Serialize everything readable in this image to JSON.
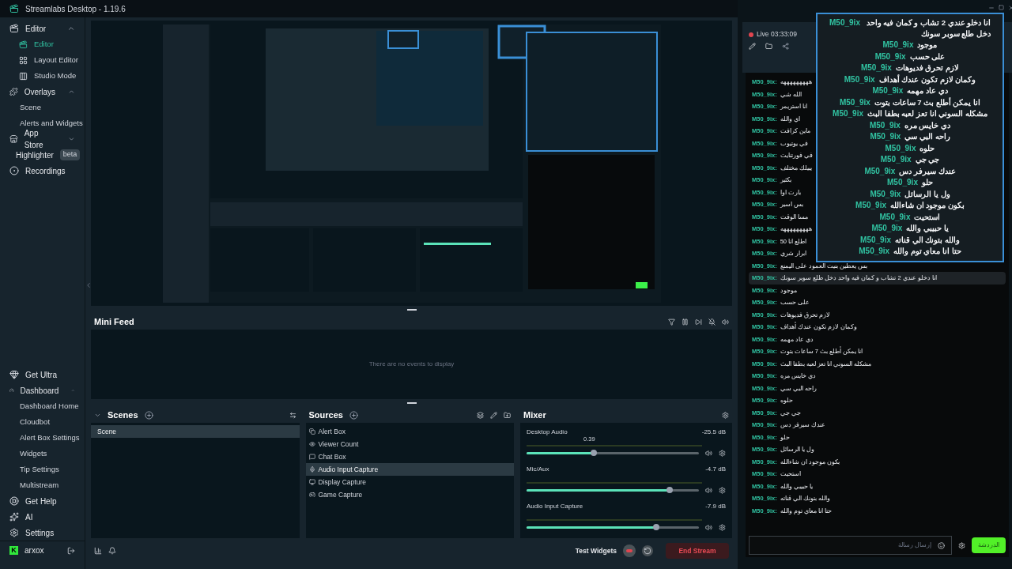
{
  "window": {
    "title": "Streamlabs Desktop - 1.19.6"
  },
  "sidebar": {
    "top_items": [
      {
        "label": "Editor",
        "expanded": true,
        "children": [
          {
            "label": "Editor",
            "selected": true
          },
          {
            "label": "Layout Editor",
            "selected": false
          },
          {
            "label": "Studio Mode",
            "selected": false
          }
        ]
      },
      {
        "label": "Overlays",
        "expanded": true,
        "children": [
          {
            "label": "Scene",
            "selected": false
          },
          {
            "label": "Alerts and Widgets",
            "selected": false
          }
        ]
      },
      {
        "label": "App Store",
        "expanded": false
      },
      {
        "label": "Highlighter",
        "badge": "beta"
      },
      {
        "label": "Recordings"
      }
    ],
    "bottom_items": [
      {
        "label": "Get Ultra"
      },
      {
        "label": "Dashboard",
        "expanded": true,
        "children": [
          {
            "label": "Dashboard Home",
            "selected": false
          },
          {
            "label": "Cloudbot",
            "selected": false
          },
          {
            "label": "Alert Box Settings",
            "selected": false
          },
          {
            "label": "Widgets",
            "selected": false
          },
          {
            "label": "Tip Settings",
            "selected": false
          },
          {
            "label": "Multistream",
            "selected": false
          }
        ]
      },
      {
        "label": "Get Help"
      },
      {
        "label": "AI"
      },
      {
        "label": "Settings"
      }
    ],
    "user": {
      "initial": "K",
      "name": "arxox"
    }
  },
  "mini_feed": {
    "title": "Mini Feed",
    "empty_text": "There are no events to display"
  },
  "scenes": {
    "title": "Scenes",
    "items": [
      {
        "label": "Scene",
        "selected": true
      }
    ]
  },
  "sources": {
    "title": "Sources",
    "items": [
      {
        "label": "Alert Box",
        "selected": false
      },
      {
        "label": "Viewer Count",
        "selected": false
      },
      {
        "label": "Chat Box",
        "selected": false
      },
      {
        "label": "Audio Input Capture",
        "selected": true
      },
      {
        "label": "Display Capture",
        "selected": false
      },
      {
        "label": "Game Capture",
        "selected": false
      }
    ]
  },
  "mixer": {
    "title": "Mixer",
    "channels": [
      {
        "name": "Desktop Audio",
        "reading": "-25.5 dB",
        "level": 0.39,
        "value_tip": "0.39"
      },
      {
        "name": "Mic/Aux",
        "reading": "-4.7 dB",
        "level": 0.83
      },
      {
        "name": "Audio Input Capture",
        "reading": "-7.9 dB",
        "level": 0.75
      }
    ]
  },
  "footer": {
    "test_widgets": "Test Widgets",
    "end_stream": "End Stream"
  },
  "chat": {
    "live": "Live 03:33:09",
    "messages": [
      {
        "user": "M50_9ix:",
        "text": "هههههههههه",
        "highlighted": false
      },
      {
        "user": "M50_9ix:",
        "text": "الله شي",
        "highlighted": false
      },
      {
        "user": "M50_9ix:",
        "text": "انا استريمر",
        "highlighted": false
      },
      {
        "user": "M50_9ix:",
        "text": "اي والله",
        "highlighted": false
      },
      {
        "user": "M50_9ix:",
        "text": "ماين كرافت",
        "highlighted": false
      },
      {
        "user": "M50_9ix:",
        "text": "في يوتيوب",
        "highlighted": false
      },
      {
        "user": "M50_9ix:",
        "text": "في فورتنايت",
        "highlighted": false
      },
      {
        "user": "M50_9ix:",
        "text": "يبيلك مختلف",
        "highlighted": false
      },
      {
        "user": "M50_9ix:",
        "text": "بكثير",
        "highlighted": false
      },
      {
        "user": "M50_9ix:",
        "text": "بارت اوا",
        "highlighted": false
      },
      {
        "user": "M50_9ix:",
        "text": "بس اسير",
        "highlighted": false
      },
      {
        "user": "M50_9ix:",
        "text": "مسا الوقت",
        "highlighted": false
      },
      {
        "user": "M50_9ix:",
        "text": "هههههههههه",
        "highlighted": false
      },
      {
        "user": "M50_9ix:",
        "text": "اطلع انا 50",
        "highlighted": false
      },
      {
        "user": "M50_9ix:",
        "text": "ابرار شري",
        "highlighted": false
      },
      {
        "user": "M50_9ix:",
        "text": "بس يعطين بنيت العمود على اليمنع",
        "highlighted": false
      },
      {
        "user": "M50_9ix:",
        "text": "انا دخلو عندي 2 تشاب و كمان فيه واحد دخل طلع سوبر سونك",
        "highlighted": true
      },
      {
        "user": "M50_9ix:",
        "text": "موجود",
        "highlighted": false
      },
      {
        "user": "M50_9ix:",
        "text": "على حسب",
        "highlighted": false
      },
      {
        "user": "M50_9ix:",
        "text": "لازم تحرق فديوهات",
        "highlighted": false
      },
      {
        "user": "M50_9ix:",
        "text": "وكمان لازم تكون عندك أهداف",
        "highlighted": false
      },
      {
        "user": "M50_9ix:",
        "text": "دي عاد مهمه",
        "highlighted": false
      },
      {
        "user": "M50_9ix:",
        "text": "انا يمكن أطلع بث 7 ساعات بتوت",
        "highlighted": false
      },
      {
        "user": "M50_9ix:",
        "text": "مشكله السوني انا تعز لعبه بطفا البث",
        "highlighted": false
      },
      {
        "user": "M50_9ix:",
        "text": "دي خايس مره",
        "highlighted": false
      },
      {
        "user": "M50_9ix:",
        "text": "راحه البي سي",
        "highlighted": false
      },
      {
        "user": "M50_9ix:",
        "text": "حلوه",
        "highlighted": false
      },
      {
        "user": "M50_9ix:",
        "text": "جي جي",
        "highlighted": false
      },
      {
        "user": "M50_9ix:",
        "text": "عندك سيرفر دس",
        "highlighted": false
      },
      {
        "user": "M50_9ix:",
        "text": "حلو",
        "highlighted": false
      },
      {
        "user": "M50_9ix:",
        "text": "ول يا الرسائل",
        "highlighted": false
      },
      {
        "user": "M50_9ix:",
        "text": "بكون موجود ان شاءالله",
        "highlighted": false
      },
      {
        "user": "M50_9ix:",
        "text": "استحيت",
        "highlighted": false
      },
      {
        "user": "M50_9ix:",
        "text": "يا حبيبي والله",
        "highlighted": false
      },
      {
        "user": "M50_9ix:",
        "text": "والله بتونك الي قناته",
        "highlighted": false
      },
      {
        "user": "M50_9ix:",
        "text": "حتا انا معاي توم والله",
        "highlighted": false
      }
    ],
    "input_placeholder": "إرسال رسالة",
    "send": "الدردشة"
  },
  "chat_overlay": {
    "messages": [
      {
        "user": "M50_9ix",
        "text": "انا دخلو عندي 2 تشاب و كمان فيه واحد دخل طلع سوبر سونك"
      },
      {
        "user": "M50_9ix",
        "text": "موجود"
      },
      {
        "user": "M50_9ix",
        "text": "على حسب"
      },
      {
        "user": "M50_9ix",
        "text": "لازم تحرق فديوهات"
      },
      {
        "user": "M50_9ix",
        "text": "وكمان لازم تكون عندك أهداف"
      },
      {
        "user": "M50_9ix",
        "text": "دي عاد مهمه"
      },
      {
        "user": "M50_9ix",
        "text": "انا يمكن أطلع بث 7 ساعات بتوت"
      },
      {
        "user": "M50_9ix",
        "text": "مشكله السوني انا تعز لعبه بطفا البث"
      },
      {
        "user": "M50_9ix",
        "text": "دي خايس مره"
      },
      {
        "user": "M50_9ix",
        "text": "راحه البي سي"
      },
      {
        "user": "M50_9ix",
        "text": "حلوه"
      },
      {
        "user": "M50_9ix",
        "text": "جي جي"
      },
      {
        "user": "M50_9ix",
        "text": "عندك سيرفر دس"
      },
      {
        "user": "M50_9ix",
        "text": "حلو"
      },
      {
        "user": "M50_9ix",
        "text": "ول يا الرسائل"
      },
      {
        "user": "M50_9ix",
        "text": "بكون موجود ان شاءالله"
      },
      {
        "user": "M50_9ix",
        "text": "استحيت"
      },
      {
        "user": "M50_9ix",
        "text": "يا حبيبي والله"
      },
      {
        "user": "M50_9ix",
        "text": "والله بتونك الي قناته"
      },
      {
        "user": "M50_9ix",
        "text": "حتا انا معاي توم والله"
      }
    ]
  }
}
